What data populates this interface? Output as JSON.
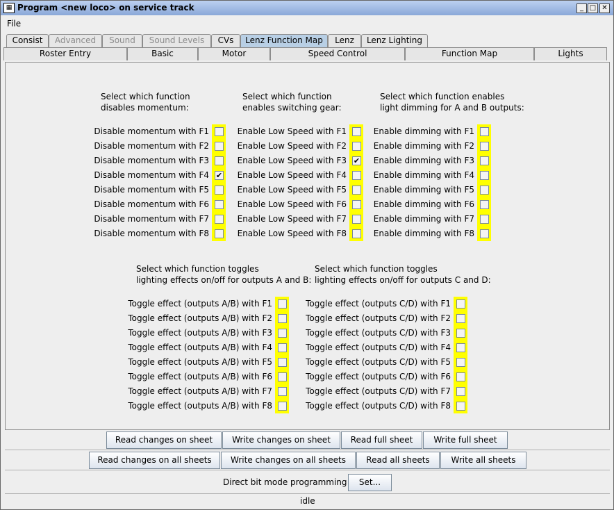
{
  "window": {
    "title": "Program <new loco> on service track",
    "icon": "loco-icon",
    "controls": [
      "minimize-icon",
      "maximize-icon",
      "close-icon"
    ]
  },
  "menu": {
    "file": "File"
  },
  "tabs_row1": [
    {
      "label": "Consist",
      "state": "normal"
    },
    {
      "label": "Advanced",
      "state": "disabled"
    },
    {
      "label": "Sound",
      "state": "disabled"
    },
    {
      "label": "Sound Levels",
      "state": "disabled"
    },
    {
      "label": "CVs",
      "state": "normal"
    },
    {
      "label": "Lenz Function Map",
      "state": "selected"
    },
    {
      "label": "Lenz",
      "state": "normal"
    },
    {
      "label": "Lenz Lighting",
      "state": "normal"
    }
  ],
  "tabs_row2": [
    "Roster Entry",
    "Basic",
    "Motor",
    "Speed Control",
    "Function Map",
    "Lights"
  ],
  "groups": {
    "momentum": {
      "head1": "Select which function",
      "head2": "disables momentum:",
      "prefix": "Disable momentum with",
      "checked": [
        false,
        false,
        false,
        true,
        false,
        false,
        false,
        false
      ]
    },
    "switching": {
      "head1": "Select which function",
      "head2": "enables switching gear:",
      "prefix": "Enable Low Speed with",
      "checked": [
        false,
        false,
        true,
        false,
        false,
        false,
        false,
        false
      ]
    },
    "dimming": {
      "head1": "Select which function enables",
      "head2": "light dimming for A and B outputs:",
      "prefix": "Enable dimming with",
      "checked": [
        false,
        false,
        false,
        false,
        false,
        false,
        false,
        false
      ]
    },
    "toggle_ab": {
      "head1": "Select which function toggles",
      "head2": "lighting effects on/off for outputs A and B:",
      "prefix": "Toggle effect (outputs A/B) with",
      "checked": [
        false,
        false,
        false,
        false,
        false,
        false,
        false,
        false
      ]
    },
    "toggle_cd": {
      "head1": "Select which function toggles",
      "head2": "lighting effects on/off for outputs C and D:",
      "prefix": "Toggle effect (outputs C/D) with",
      "checked": [
        false,
        false,
        false,
        false,
        false,
        false,
        false,
        false
      ]
    }
  },
  "functions": [
    "F1",
    "F2",
    "F3",
    "F4",
    "F5",
    "F6",
    "F7",
    "F8"
  ],
  "sheet_buttons": {
    "read_changes": "Read changes on sheet",
    "write_changes": "Write changes on sheet",
    "read_full": "Read full sheet",
    "write_full": "Write full sheet"
  },
  "all_buttons": {
    "read_changes_all": "Read changes on all sheets",
    "write_changes_all": "Write changes on all sheets",
    "read_all": "Read all sheets",
    "write_all": "Write all sheets"
  },
  "direct": {
    "label": "Direct bit mode programming",
    "set": "Set..."
  },
  "status": "idle",
  "colors": {
    "highlight": "#ffff00",
    "selected_tab": "#b8cfe5",
    "titlebar": "#8aa8d8"
  }
}
